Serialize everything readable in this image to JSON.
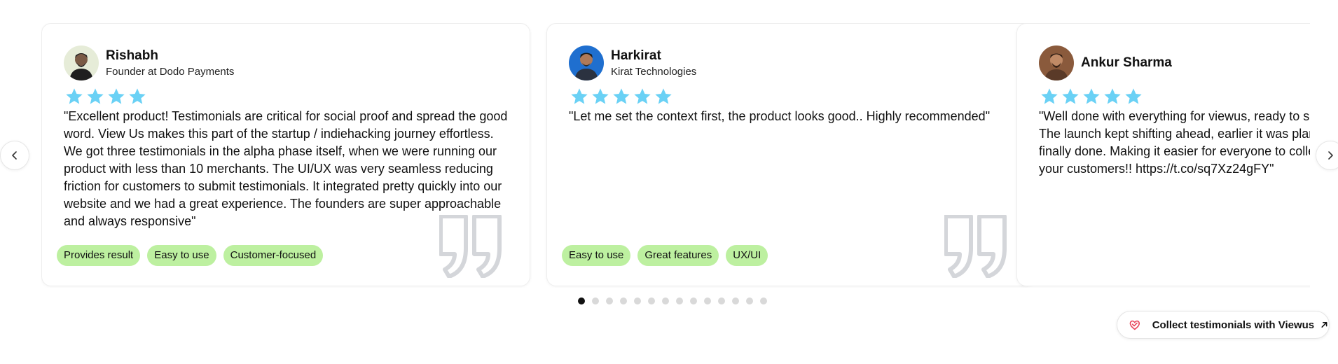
{
  "accent": {
    "star": "#6ad1f5",
    "tag_bg": "#bdf0a0",
    "quote_mark": "#d4d6da"
  },
  "testimonials": [
    {
      "name": "Rishabh",
      "role": "Founder at Dodo Payments",
      "rating": 4,
      "text": "\"Excellent product! Testimonials are critical for social proof and spread the good word. View Us makes this part of the startup / indiehacking journey effortless. We got three testimonials in the alpha phase itself, when we were running our product with less than 10 merchants. The UI/UX was very seamless reducing friction for customers to submit testimonials. It integrated pretty quickly into our website and we had a great experience. The founders are super approachable and always responsive\"",
      "tags": [
        "Provides result",
        "Easy to use",
        "Customer-focused"
      ]
    },
    {
      "name": "Harkirat",
      "role": "Kirat Technologies",
      "rating": 5,
      "text": "\"Let me set the context first, the product looks good.. Highly recommended\"",
      "tags": [
        "Easy to use",
        "Great features",
        "UX/UI"
      ]
    },
    {
      "name": "Ankur Sharma",
      "role": "",
      "rating": 5,
      "text": "\"Well done with everything for viewus, ready to share this since December... The launch kept shifting ahead, earlier it was planned for December, but we are finally done. Making it easier for everyone to collect testimonials from among your customers!! https://t.co/sq7Xz24gFY\"",
      "tags": []
    }
  ],
  "carousel": {
    "slide_count": 14,
    "active_index": 0
  },
  "cta": {
    "label": "Collect testimonials with Viewus",
    "logo_icon": "viewus-logo-icon",
    "arrow_icon": "arrow-up-right-icon"
  }
}
